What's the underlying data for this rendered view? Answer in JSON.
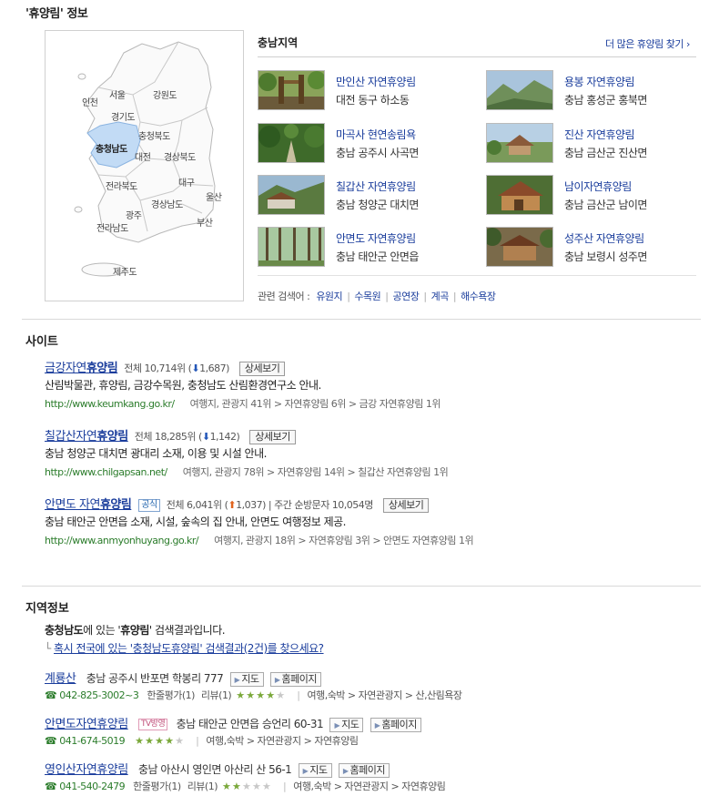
{
  "section1": {
    "title": "'휴양림' 정보",
    "map_labels": [
      {
        "name": "서울",
        "active": false
      },
      {
        "name": "인천",
        "active": false
      },
      {
        "name": "강원도",
        "active": false
      },
      {
        "name": "경기도",
        "active": false
      },
      {
        "name": "충청북도",
        "active": false
      },
      {
        "name": "충청남도",
        "active": true
      },
      {
        "name": "대전",
        "active": false
      },
      {
        "name": "경상북도",
        "active": false
      },
      {
        "name": "전라북도",
        "active": false
      },
      {
        "name": "대구",
        "active": false
      },
      {
        "name": "울산",
        "active": false
      },
      {
        "name": "경상남도",
        "active": false
      },
      {
        "name": "광주",
        "active": false
      },
      {
        "name": "부산",
        "active": false
      },
      {
        "name": "전라남도",
        "active": false
      },
      {
        "name": "제주도",
        "active": false
      }
    ],
    "region_title": "충남지역",
    "more_link": "더 많은 휴양림 찾기 ›",
    "forests": [
      {
        "name": "만인산 자연휴양림",
        "addr": "대전 동구 하소동"
      },
      {
        "name": "용봉 자연휴양림",
        "addr": "충남 홍성군 홍북면"
      },
      {
        "name": "마곡사 현연송림욕",
        "addr": "충남 공주시 사곡면"
      },
      {
        "name": "진산 자연휴양림",
        "addr": "충남 금산군 진산면"
      },
      {
        "name": "칠갑산 자연휴양림",
        "addr": "충남 청양군 대치면"
      },
      {
        "name": "남이자연휴양림",
        "addr": "충남 금산군 남이면"
      },
      {
        "name": "안면도 자연휴양림",
        "addr": "충남 태안군 안면읍"
      },
      {
        "name": "성주산 자연휴양림",
        "addr": "충남 보령시 성주면"
      }
    ],
    "related_label": "관련 검색어 :",
    "related": [
      "유원지",
      "수목원",
      "공연장",
      "계곡",
      "해수욕장"
    ]
  },
  "sites": {
    "title": "사이트",
    "detail_label": "상세보기",
    "items": [
      {
        "name_pre": "금강자연",
        "name_bold": "휴양림",
        "rank": "전체 10,714위 (",
        "arrow": "down",
        "change": "1,687)",
        "official": "",
        "visitors": "",
        "desc": "산림박물관, 휴양림, 금강수목원, 충청남도 산림환경연구소 안내.",
        "url": "http://www.keumkang.go.kr/",
        "path": "여행지, 관광지 41위 > 자연휴양림 6위 > 금강 자연휴양림 1위"
      },
      {
        "name_pre": "칠갑산자연",
        "name_bold": "휴양림",
        "rank": "전체 18,285위 (",
        "arrow": "down",
        "change": "1,142)",
        "official": "",
        "visitors": "",
        "desc": "충남 청양군 대치면 광대리 소재, 이용 및 시설 안내.",
        "url": "http://www.chilgapsan.net/",
        "path": "여행지, 관광지 78위 > 자연휴양림 14위 > 칠갑산 자연휴양림 1위"
      },
      {
        "name_pre": "안면도 자연",
        "name_bold": "휴양림",
        "rank": "전체 6,041위 (",
        "arrow": "up",
        "change": "1,037)",
        "official": "공식",
        "visitors": "| 주간 순방문자 10,054명",
        "desc": "충남 태안군 안면읍 소재, 시설, 숲속의 집 안내, 안면도 여행정보 제공.",
        "url": "http://www.anmyonhuyang.go.kr/",
        "path": "여행지, 관광지 18위 > 자연휴양림 3위 > 안면도 자연휴양림 1위"
      }
    ]
  },
  "regional": {
    "title": "지역정보",
    "intro_region": "충청남도",
    "intro_mid": "에 있는 '",
    "intro_keyword": "휴양림",
    "intro_end": "' 검색결과입니다.",
    "alt_prefix": "└ ",
    "alt_text": "혹시 전국에 있는 '충청남도휴양림' 검색결과(2건)를 찾으세요?",
    "map_btn": "지도",
    "home_btn": "홈페이지",
    "places": [
      {
        "name": "계룡산",
        "tv": "",
        "addr": "충남 공주시 반포면 학봉리 777",
        "phone": "☎ 042-825-3002~3",
        "review_count": "한줄평가(1)",
        "reviews": "리뷰(1)",
        "rating": 4,
        "category": "여행,숙박 > 자연관광지 > 산,산림욕장"
      },
      {
        "name": "안면도자연휴양림",
        "tv": "TV방영",
        "addr": "충남 태안군 안면읍 승언리 60-31",
        "phone": "☎ 041-674-5019",
        "review_count": "",
        "reviews": "",
        "rating": 4,
        "category": "여행,숙박 > 자연관광지 > 자연휴양림"
      },
      {
        "name": "영인산자연휴양림",
        "tv": "",
        "addr": "충남 아산시 영인면 아산리 산 56-1",
        "phone": "☎ 041-540-2479",
        "review_count": "한줄평가(1)",
        "reviews": "리뷰(1)",
        "rating": 2,
        "category": "여행,숙박 > 자연관광지 > 자연휴양림"
      }
    ]
  }
}
